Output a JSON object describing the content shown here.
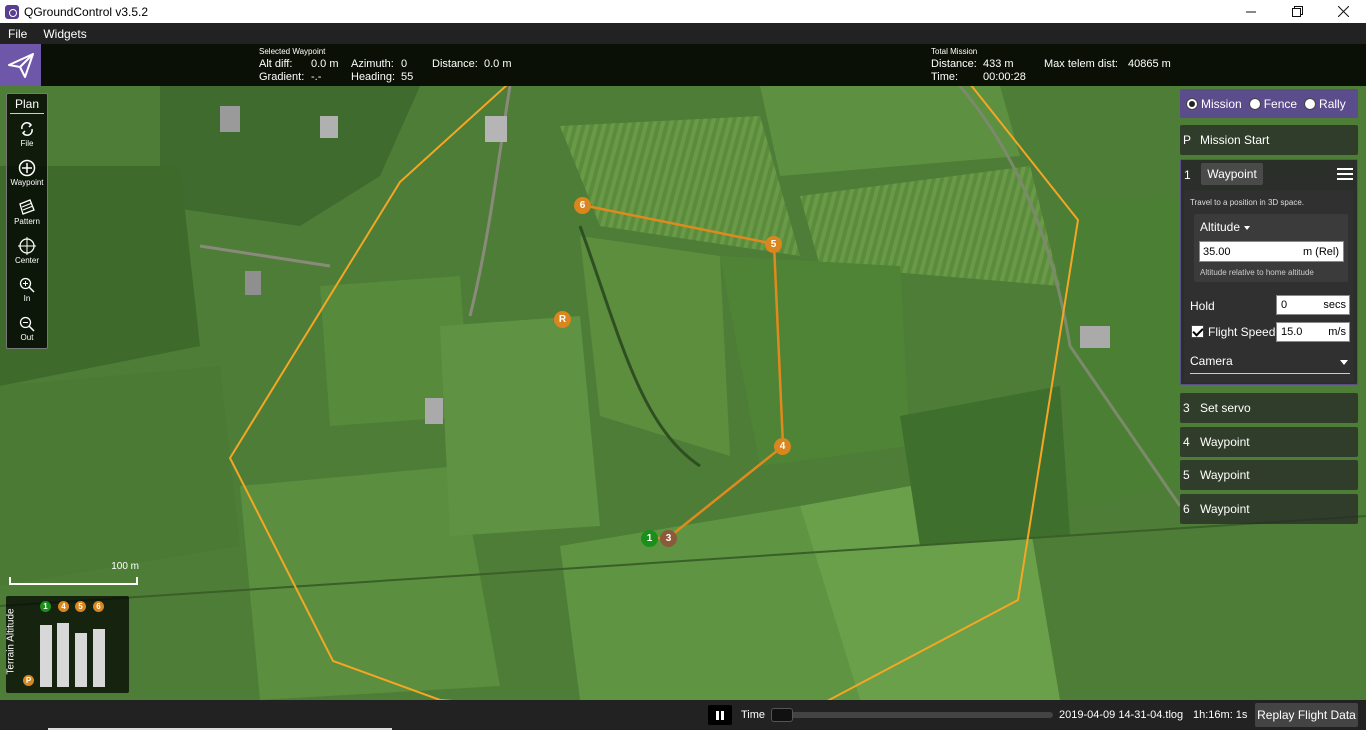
{
  "window": {
    "title": "QGroundControl v3.5.2"
  },
  "menu": {
    "items": [
      "File",
      "Widgets"
    ]
  },
  "toolbar": {
    "selected_waypoint": {
      "heading": "Selected Waypoint",
      "alt_diff_label": "Alt diff:",
      "alt_diff_value": "0.0 m",
      "azimuth_label": "Azimuth:",
      "azimuth_value": "0",
      "distance_label": "Distance:",
      "distance_value": "0.0 m",
      "gradient_label": "Gradient:",
      "gradient_value": "-.-",
      "heading_label": "Heading:",
      "heading_value": "55"
    },
    "total_mission": {
      "heading": "Total Mission",
      "distance_label": "Distance:",
      "distance_value": "433 m",
      "time_label": "Time:",
      "time_value": "00:00:28",
      "max_telem_label": "Max telem dist:",
      "max_telem_value": "40865 m"
    }
  },
  "plan_tools": {
    "title": "Plan",
    "tools": [
      {
        "label": "File",
        "icon": "file-sync-icon"
      },
      {
        "label": "Waypoint",
        "icon": "add-waypoint-icon"
      },
      {
        "label": "Pattern",
        "icon": "pattern-icon"
      },
      {
        "label": "Center",
        "icon": "center-icon"
      },
      {
        "label": "In",
        "icon": "zoom-in-icon"
      },
      {
        "label": "Out",
        "icon": "zoom-out-icon"
      }
    ]
  },
  "map": {
    "scale_label": "100 m",
    "markers": {
      "wp1": "1",
      "wp3": "3",
      "wp4": "4",
      "wp5": "5",
      "wp6": "6",
      "rally": "R"
    },
    "colors": {
      "path": "#e08a1e",
      "fence": "#f5a623",
      "home": "#1a8f1a",
      "waypoint": "#d9861e"
    }
  },
  "terrain": {
    "title": "Terrain Altitude",
    "markers": [
      "1",
      "4",
      "5",
      "6"
    ],
    "home": "P"
  },
  "panel": {
    "modes": [
      {
        "label": "Mission",
        "checked": true
      },
      {
        "label": "Fence",
        "checked": false
      },
      {
        "label": "Rally",
        "checked": false
      }
    ],
    "mission_start": {
      "seq": "P",
      "label": "Mission Start"
    },
    "current": {
      "seq": "1",
      "type": "Waypoint",
      "description": "Travel to a position in 3D space.",
      "altitude_label": "Altitude",
      "altitude_value": "35.00",
      "altitude_unit": "m (Rel)",
      "altitude_help": "Altitude relative to home altitude",
      "hold_label": "Hold",
      "hold_value": "0",
      "hold_unit": "secs",
      "speed_label": "Flight Speed",
      "speed_value": "15.0",
      "speed_unit": "m/s",
      "camera_label": "Camera"
    },
    "items": [
      {
        "seq": "3",
        "label": "Set servo"
      },
      {
        "seq": "4",
        "label": "Waypoint"
      },
      {
        "seq": "5",
        "label": "Waypoint"
      },
      {
        "seq": "6",
        "label": "Waypoint"
      }
    ]
  },
  "bottom": {
    "time_label": "Time",
    "log_file": "2019-04-09 14-31-04.tlog",
    "duration": "1h:16m: 1s",
    "replay_label": "Replay Flight Data"
  }
}
